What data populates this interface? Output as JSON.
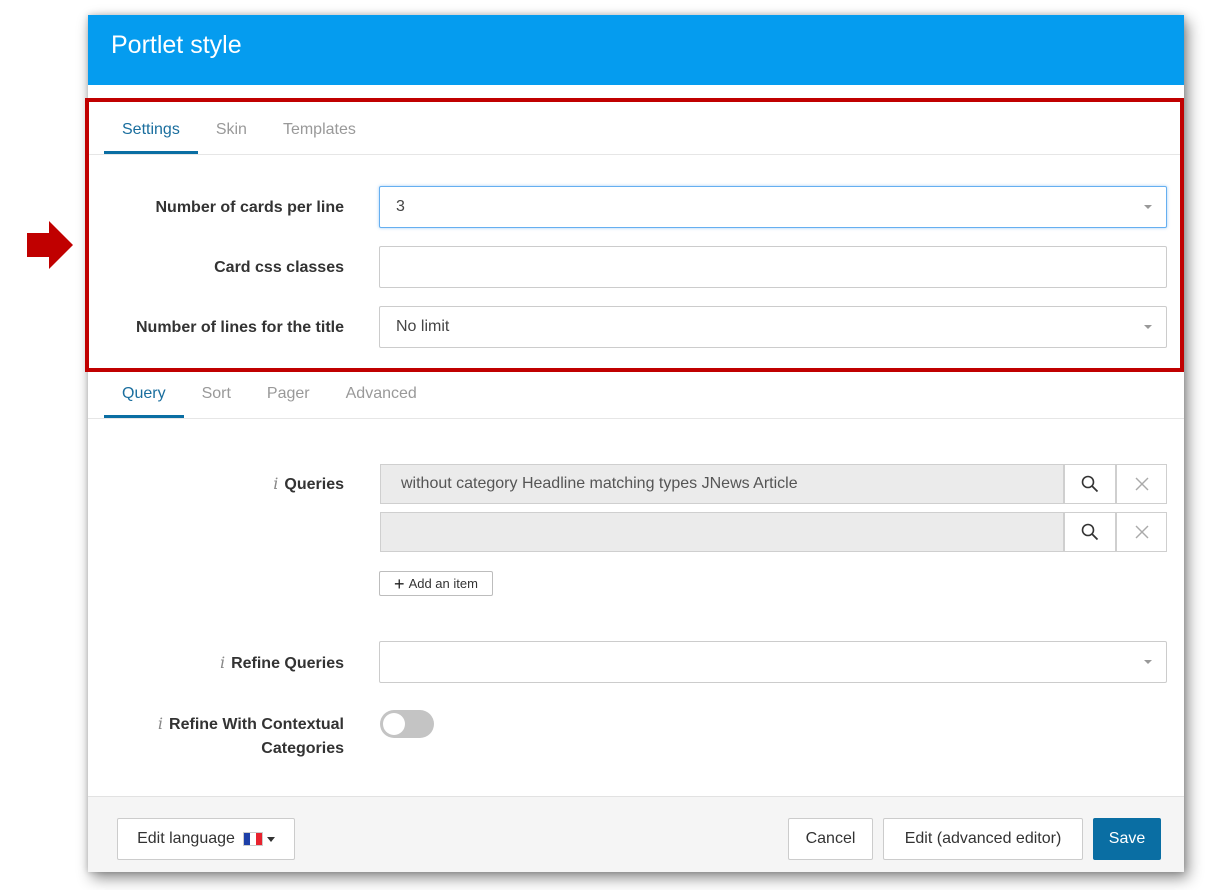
{
  "modal": {
    "title": "Portlet style"
  },
  "tabs_top": [
    {
      "label": "Settings",
      "active": true
    },
    {
      "label": "Skin",
      "active": false
    },
    {
      "label": "Templates",
      "active": false
    }
  ],
  "settings": {
    "cards_per_line": {
      "label": "Number of cards per line",
      "value": "3"
    },
    "card_css": {
      "label": "Card css classes",
      "value": ""
    },
    "title_lines": {
      "label": "Number of lines for the title",
      "value": "No limit"
    }
  },
  "tabs_bottom": [
    {
      "label": "Query",
      "active": true
    },
    {
      "label": "Sort",
      "active": false
    },
    {
      "label": "Pager",
      "active": false
    },
    {
      "label": "Advanced",
      "active": false
    }
  ],
  "query": {
    "info_glyph": "i",
    "queries_label": "Queries",
    "items": [
      "without category Headline matching types JNews Article",
      ""
    ],
    "add_item_label": "Add an item",
    "refine_label": "Refine Queries",
    "refine_value": "",
    "contextual_label_line1": "Refine With Contextual",
    "contextual_label_line2": "Categories",
    "contextual_enabled": false
  },
  "footer": {
    "edit_language": "Edit language",
    "language_flag": "fr-flag",
    "cancel": "Cancel",
    "advanced_editor": "Edit (advanced editor)",
    "save": "Save"
  },
  "colors": {
    "header": "#059cef",
    "accent": "#0a6ea3",
    "highlight": "#c00000"
  }
}
